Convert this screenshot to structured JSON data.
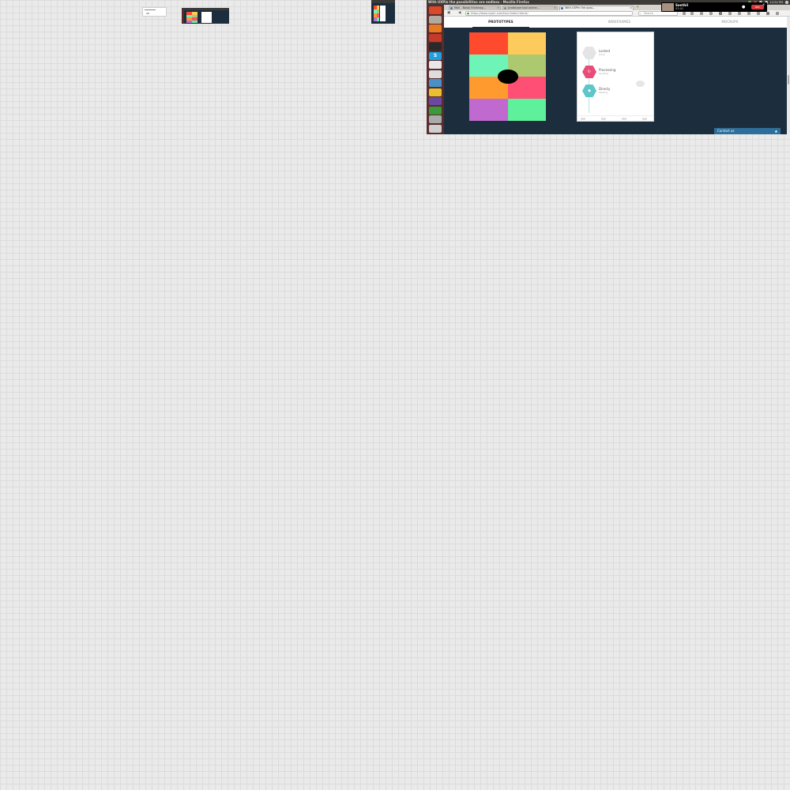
{
  "window": {
    "title": "With UXPin the possibilities are endless - Mozilla Firefox",
    "tray_items": [
      "12:54 PM"
    ]
  },
  "browser": {
    "tabs": [
      {
        "label": "Mail - Balaji Krishnag...",
        "active": false,
        "icon_color": "#3d7ac7"
      },
      {
        "label": "prototype tool online...",
        "active": false,
        "icon_color": "#888888"
      },
      {
        "label": "With UXPin the poss...",
        "active": true,
        "icon_color": "#2b6cb0"
      }
    ],
    "url": "https://www.uxpin.com/tour/index.html#/",
    "search_placeholder": "Search"
  },
  "notification": {
    "name": "Senthil",
    "time": "03:41",
    "record_label": "REC"
  },
  "site": {
    "nav_tabs": [
      "PROTOTYPES",
      "WIREFRAMES",
      "MOCKUPS"
    ],
    "active_tab": "PROTOTYPES",
    "contact_label": "Contact us"
  },
  "color_grid": {
    "colors": [
      "#ff4a2e",
      "#fccb5c",
      "#6ff4b7",
      "#acc96f",
      "#ff9a2e",
      "#ff4f74",
      "#c06ad0",
      "#5ef09a"
    ]
  },
  "phone": {
    "steps": [
      {
        "label": "Locked",
        "sub": "Done",
        "color": "#e4e4e4",
        "icon": "lock-icon"
      },
      {
        "label": "Processing",
        "sub": "Sending",
        "color": "#e84d7a",
        "icon": "refresh-icon"
      },
      {
        "label": "Directy",
        "sub": "Waiting",
        "color": "#5cc6c8",
        "icon": "diamond-icon"
      }
    ]
  },
  "launcher": {
    "icons": [
      {
        "name": "ubuntu-dash-icon",
        "color": "#d64a2a",
        "glyph": ""
      },
      {
        "name": "files-icon",
        "color": "#b0aaa0",
        "glyph": ""
      },
      {
        "name": "firefox-icon",
        "color": "#e67a22",
        "glyph": ""
      },
      {
        "name": "software-center-icon",
        "color": "#c63a2a",
        "glyph": ""
      },
      {
        "name": "terminal-icon",
        "color": "#2a2a2a",
        "glyph": ""
      },
      {
        "name": "skype-icon",
        "color": "#1fa0e0",
        "glyph": "S"
      },
      {
        "name": "text-editor-icon",
        "color": "#e8e8e8",
        "glyph": ""
      },
      {
        "name": "diagram-icon",
        "color": "#dddddd",
        "glyph": ""
      },
      {
        "name": "cloud-icon",
        "color": "#4a90c8",
        "glyph": ""
      },
      {
        "name": "chrome-icon",
        "color": "#e8c030",
        "glyph": ""
      },
      {
        "name": "vpn-icon",
        "color": "#6a4aa0",
        "glyph": ""
      },
      {
        "name": "spreadsheet-icon",
        "color": "#3a9a3a",
        "glyph": ""
      },
      {
        "name": "drive-icon",
        "color": "#aaaaaa",
        "glyph": ""
      },
      {
        "name": "trash-icon",
        "color": "#cfcfcf",
        "glyph": ""
      }
    ]
  }
}
